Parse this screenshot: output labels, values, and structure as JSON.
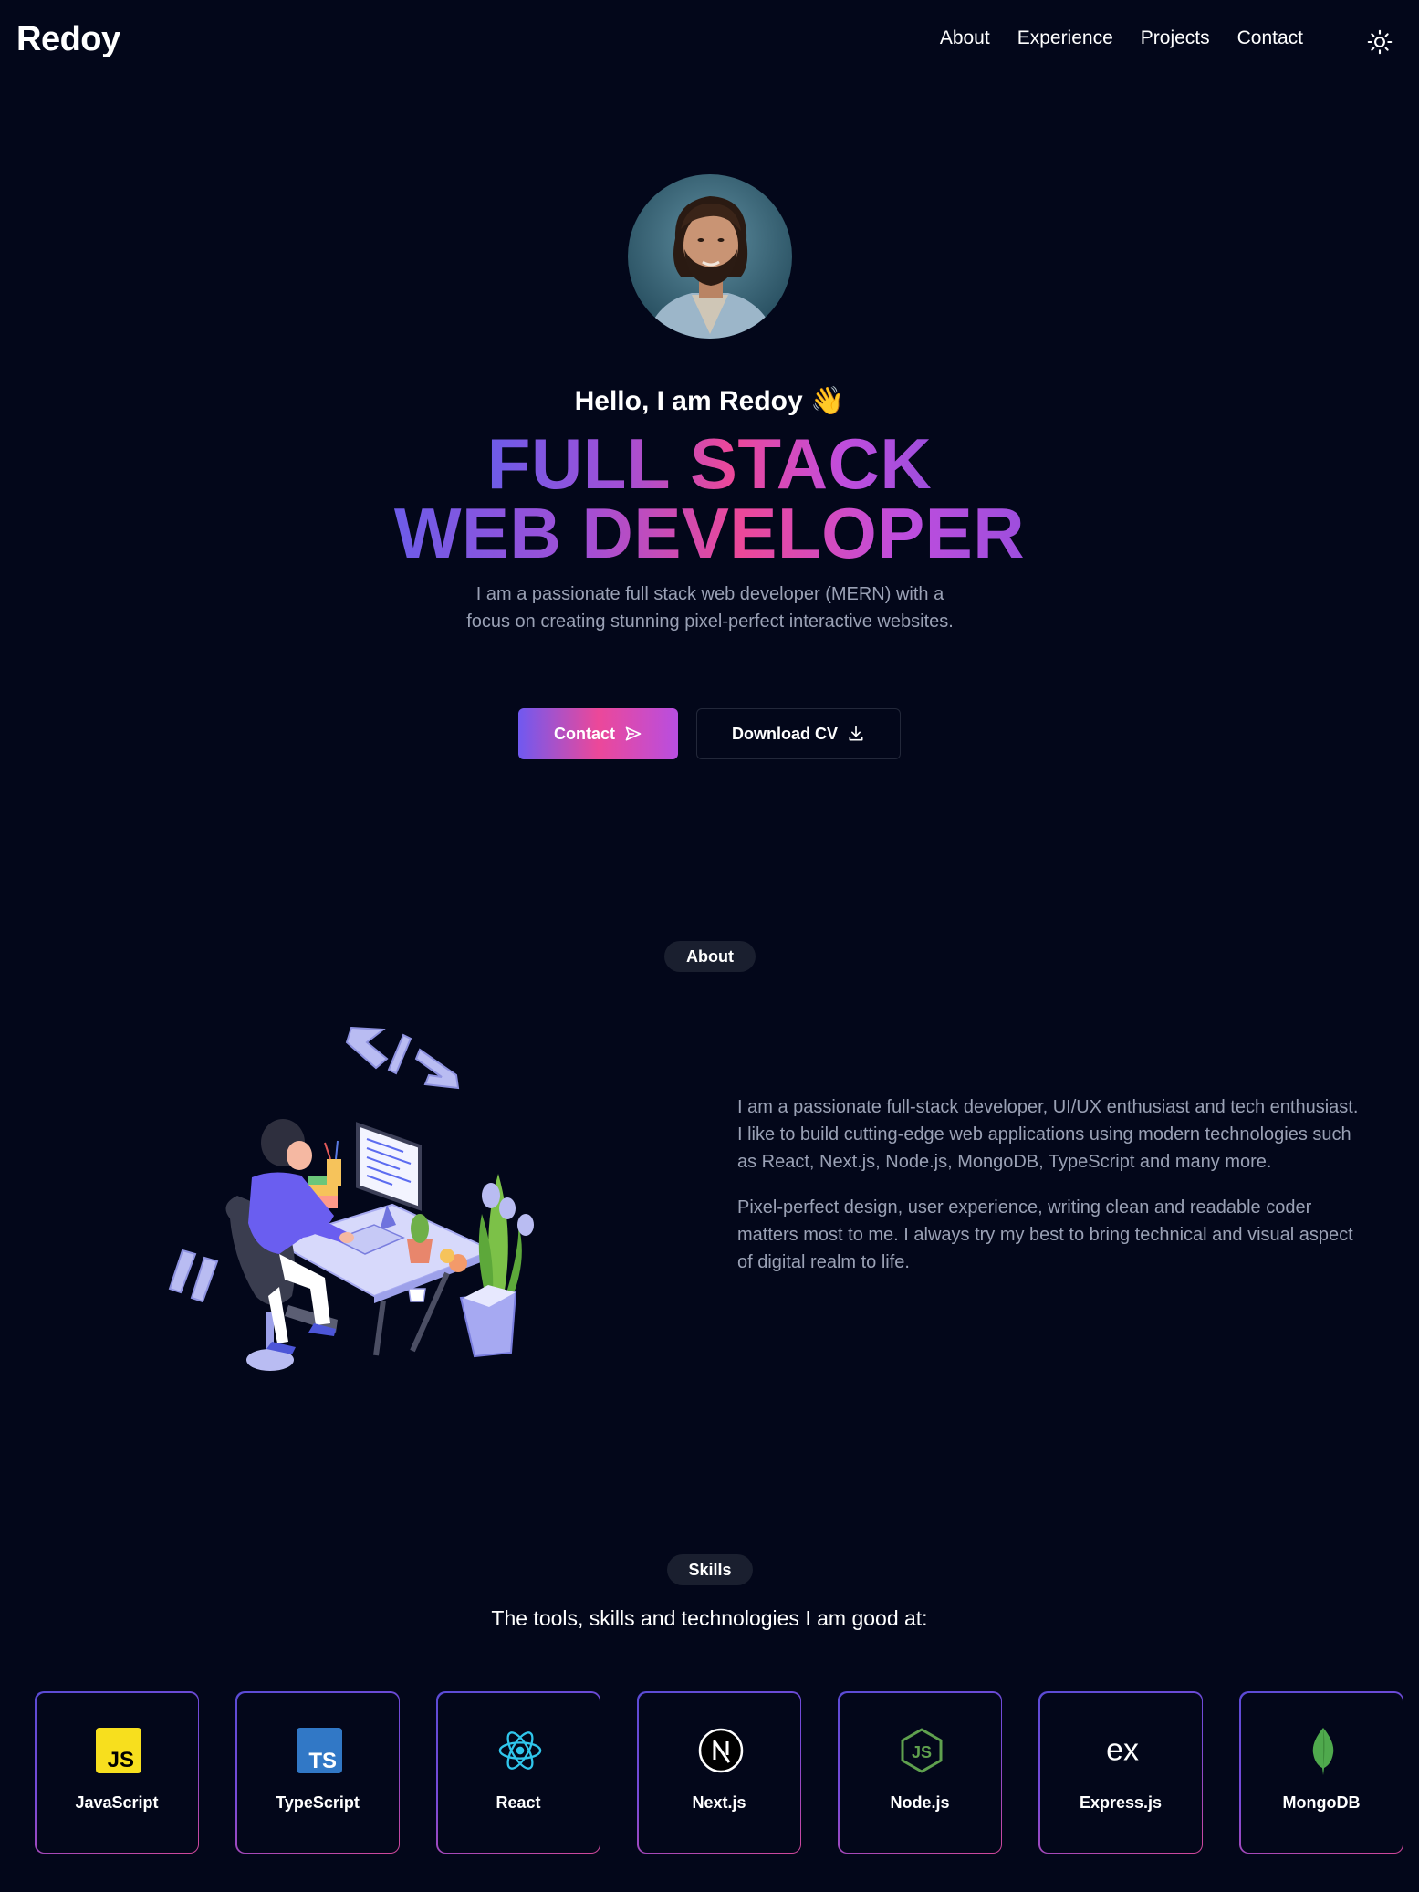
{
  "nav": {
    "logo": "Redoy",
    "links": [
      "About",
      "Experience",
      "Projects",
      "Contact"
    ],
    "theme_toggle_icon": "sun-icon"
  },
  "hero": {
    "greeting": "Hello, I am Redoy 👋",
    "title_line1": "FULL STACK",
    "title_line2": "WEB DEVELOPER",
    "intro": "I am a passionate full stack web developer (MERN) with a focus on creating stunning pixel-perfect interactive websites.",
    "contact_button": "Contact",
    "cv_button": "Download CV"
  },
  "about": {
    "badge": "About",
    "paragraph1": "I am a passionate full-stack developer, UI/UX enthusiast and tech enthusiast. I like to build cutting-edge web applications using modern technologies such as React, Next.js, Node.js, MongoDB, TypeScript and many more.",
    "paragraph2": "Pixel-perfect design, user experience, writing clean and readable coder matters most to me. I always try my best to bring technical and visual aspect of digital realm to life."
  },
  "skills": {
    "badge": "Skills",
    "subtitle": "The tools, skills and technologies I am good at:",
    "items": [
      {
        "name": "JavaScript",
        "icon": "javascript-icon"
      },
      {
        "name": "TypeScript",
        "icon": "typescript-icon"
      },
      {
        "name": "React",
        "icon": "react-icon"
      },
      {
        "name": "Next.js",
        "icon": "nextjs-icon"
      },
      {
        "name": "Node.js",
        "icon": "nodejs-icon"
      },
      {
        "name": "Express.js",
        "icon": "expressjs-icon"
      },
      {
        "name": "MongoDB",
        "icon": "mongodb-icon"
      }
    ]
  },
  "colors": {
    "background": "#03071a",
    "accent_purple": "#7059f0",
    "accent_pink": "#ec4899",
    "muted_text": "#9aa1b5"
  }
}
